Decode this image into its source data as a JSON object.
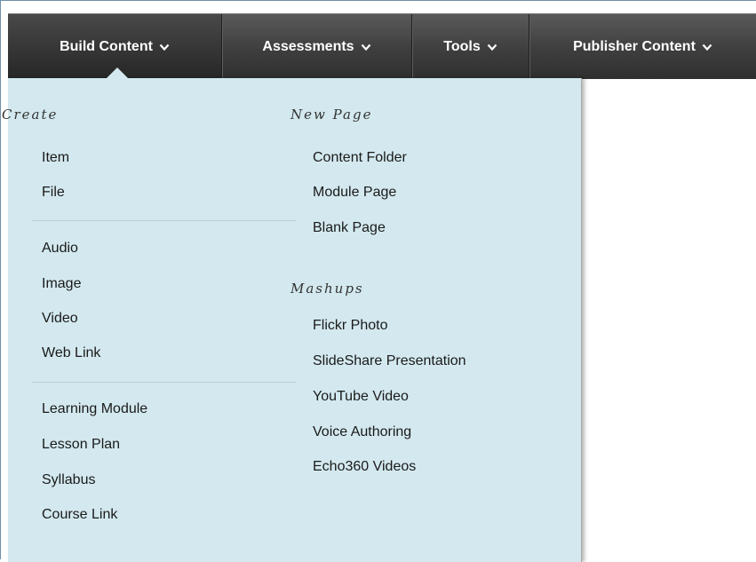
{
  "nav": {
    "build_content": "Build Content",
    "assessments": "Assessments",
    "tools": "Tools",
    "publisher_content": "Publisher Content"
  },
  "menu": {
    "create_heading": "Create",
    "create_group1": [
      "Item",
      "File"
    ],
    "create_group2": [
      "Audio",
      "Image",
      "Video",
      "Web Link"
    ],
    "create_group3": [
      "Learning Module",
      "Lesson Plan",
      "Syllabus",
      "Course Link"
    ],
    "new_page_heading": "New Page",
    "new_page_items": [
      "Content Folder",
      "Module Page",
      "Blank Page"
    ],
    "mashups_heading": "Mashups",
    "mashups_items": [
      "Flickr Photo",
      "SlideShare Presentation",
      "YouTube Video",
      "Voice Authoring",
      "Echo360 Videos"
    ]
  },
  "colors": {
    "bar": "#3e3e3e",
    "menu_bg": "#d3e9ef",
    "text": "#1a1a1a"
  },
  "icons": {
    "dropdown": "chevron-down-icon"
  }
}
